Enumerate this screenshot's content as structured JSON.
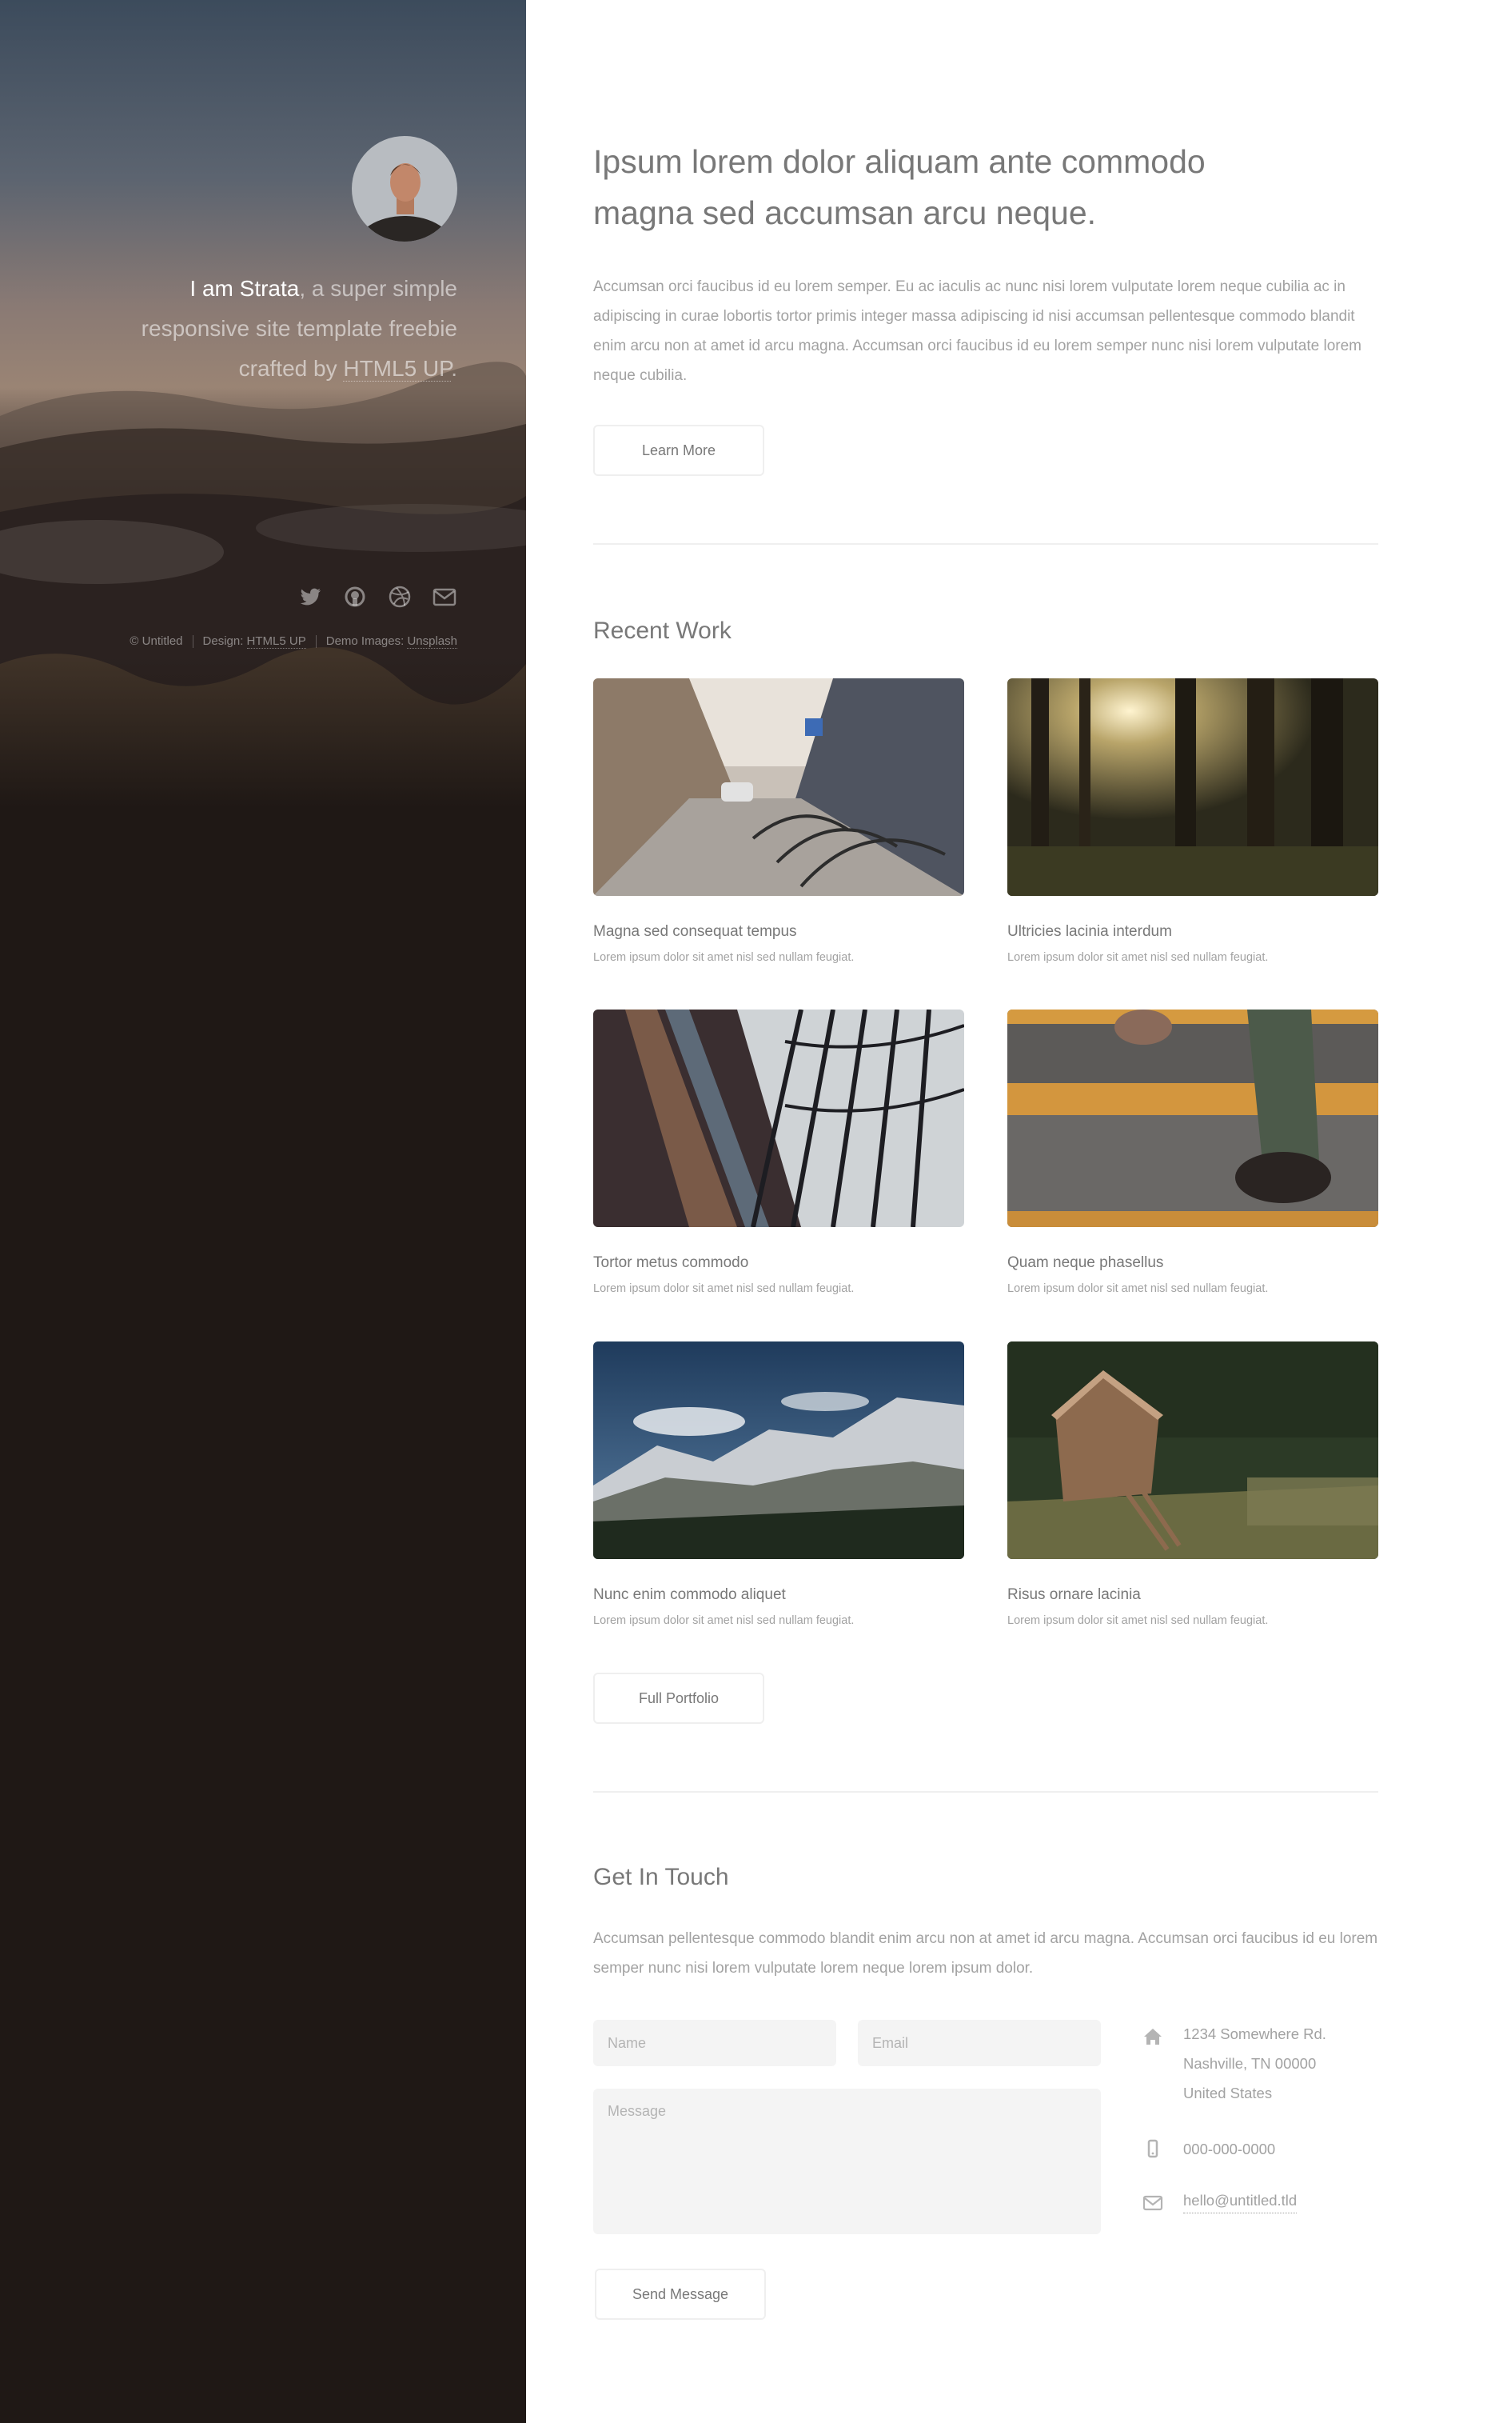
{
  "sidebar": {
    "intro_strong": "I am Strata",
    "intro_line1_rest": ", a super simple",
    "intro_line2": "responsive site template freebie",
    "intro_line3_pre": "crafted by ",
    "intro_line3_link": "HTML5 UP",
    "intro_line3_post": ".",
    "social_icons": [
      "twitter-icon",
      "github-icon",
      "dribbble-icon",
      "envelope-icon"
    ],
    "copyright": {
      "text": "© Untitled",
      "design_label": "Design:",
      "design_link": "HTML5 UP",
      "images_label": "Demo Images:",
      "images_link": "Unsplash"
    }
  },
  "main": {
    "headline_line1": "Ipsum lorem dolor aliquam ante commodo",
    "headline_line2": "magna sed accumsan arcu neque.",
    "intro_paragraph": "Accumsan orci faucibus id eu lorem semper. Eu ac iaculis ac nunc nisi lorem vulputate lorem neque cubilia ac in adipiscing in curae lobortis tortor primis integer massa adipiscing id nisi accumsan pellentesque commodo blandit enim arcu non at amet id arcu magna. Accumsan orci faucibus id eu lorem semper nunc nisi lorem vulputate lorem neque cubilia.",
    "learn_more_label": "Learn More",
    "recent_work": {
      "title": "Recent Work",
      "items": [
        {
          "title": "Magna sed consequat tempus",
          "desc": "Lorem ipsum dolor sit amet nisl sed nullam feugiat."
        },
        {
          "title": "Ultricies lacinia interdum",
          "desc": "Lorem ipsum dolor sit amet nisl sed nullam feugiat."
        },
        {
          "title": "Tortor metus commodo",
          "desc": "Lorem ipsum dolor sit amet nisl sed nullam feugiat."
        },
        {
          "title": "Quam neque phasellus",
          "desc": "Lorem ipsum dolor sit amet nisl sed nullam feugiat."
        },
        {
          "title": "Nunc enim commodo aliquet",
          "desc": "Lorem ipsum dolor sit amet nisl sed nullam feugiat."
        },
        {
          "title": "Risus ornare lacinia",
          "desc": "Lorem ipsum dolor sit amet nisl sed nullam feugiat."
        }
      ],
      "portfolio_label": "Full Portfolio"
    },
    "contact": {
      "title": "Get In Touch",
      "text": "Accumsan pellentesque commodo blandit enim arcu non at amet id arcu magna. Accumsan orci faucibus id eu lorem semper nunc nisi lorem vulputate lorem neque lorem ipsum dolor.",
      "name_placeholder": "Name",
      "email_placeholder": "Email",
      "message_placeholder": "Message",
      "send_label": "Send Message",
      "address_line1": "1234 Somewhere Rd.",
      "address_line2": "Nashville, TN 00000",
      "address_line3": "United States",
      "phone": "000-000-0000",
      "email": "hello@untitled.tld"
    }
  },
  "colors": {
    "sidebar_bg": "#1f1815",
    "heading": "#787878",
    "body_text": "#a2a2a2",
    "field_bg": "#f4f4f4"
  }
}
